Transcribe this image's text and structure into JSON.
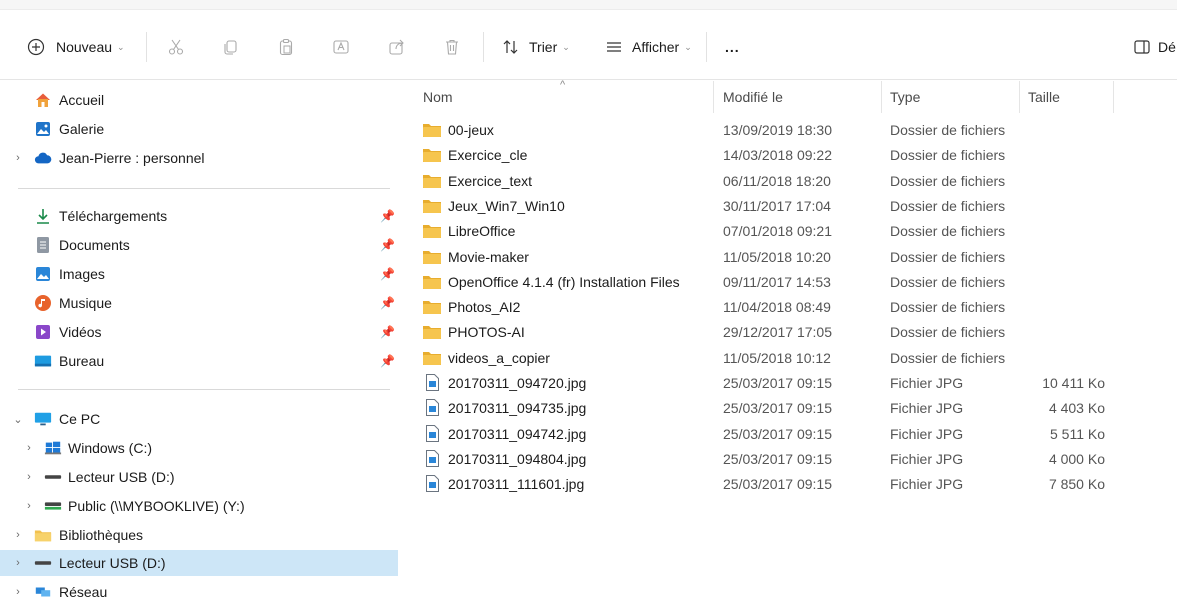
{
  "toolbar": {
    "new_label": "Nouveau",
    "sort_label": "Trier",
    "view_label": "Afficher",
    "more_label": "...",
    "details_label": "Dé"
  },
  "sidebar": {
    "quick": [
      {
        "label": "Accueil",
        "icon": "home-icon"
      },
      {
        "label": "Galerie",
        "icon": "gallery-icon"
      },
      {
        "label": "Jean-Pierre : personnel",
        "icon": "cloud-icon"
      }
    ],
    "pinned": [
      {
        "label": "Téléchargements",
        "icon": "download-icon"
      },
      {
        "label": "Documents",
        "icon": "documents-icon"
      },
      {
        "label": "Images",
        "icon": "images-icon"
      },
      {
        "label": "Musique",
        "icon": "music-icon"
      },
      {
        "label": "Vidéos",
        "icon": "videos-icon"
      },
      {
        "label": "Bureau",
        "icon": "desktop-icon"
      }
    ],
    "tree": [
      {
        "label": "Ce PC",
        "icon": "pc-icon"
      },
      {
        "label": "Windows (C:)",
        "icon": "windows-drive-icon"
      },
      {
        "label": "Lecteur USB (D:)",
        "icon": "usb-drive-icon"
      },
      {
        "label": "Public (\\\\MYBOOKLIVE) (Y:)",
        "icon": "network-drive-icon"
      },
      {
        "label": "Bibliothèques",
        "icon": "library-folder-icon"
      },
      {
        "label": "Lecteur USB (D:)",
        "icon": "usb-drive-icon"
      },
      {
        "label": "Réseau",
        "icon": "network-icon"
      }
    ]
  },
  "columns": {
    "name": "Nom",
    "modified": "Modifié le",
    "type": "Type",
    "size": "Taille"
  },
  "files": [
    {
      "name": "00-jeux",
      "modified": "13/09/2019 18:30",
      "type": "Dossier de fichiers",
      "size": "",
      "kind": "folder"
    },
    {
      "name": "Exercice_cle",
      "modified": "14/03/2018 09:22",
      "type": "Dossier de fichiers",
      "size": "",
      "kind": "folder"
    },
    {
      "name": "Exercice_text",
      "modified": "06/11/2018 18:20",
      "type": "Dossier de fichiers",
      "size": "",
      "kind": "folder"
    },
    {
      "name": "Jeux_Win7_Win10",
      "modified": "30/11/2017 17:04",
      "type": "Dossier de fichiers",
      "size": "",
      "kind": "folder"
    },
    {
      "name": "LibreOffice",
      "modified": "07/01/2018 09:21",
      "type": "Dossier de fichiers",
      "size": "",
      "kind": "folder"
    },
    {
      "name": "Movie-maker",
      "modified": "11/05/2018 10:20",
      "type": "Dossier de fichiers",
      "size": "",
      "kind": "folder"
    },
    {
      "name": "OpenOffice 4.1.4 (fr) Installation Files",
      "modified": "09/11/2017 14:53",
      "type": "Dossier de fichiers",
      "size": "",
      "kind": "folder"
    },
    {
      "name": "Photos_AI2",
      "modified": "11/04/2018 08:49",
      "type": "Dossier de fichiers",
      "size": "",
      "kind": "folder"
    },
    {
      "name": "PHOTOS-AI",
      "modified": "29/12/2017 17:05",
      "type": "Dossier de fichiers",
      "size": "",
      "kind": "folder"
    },
    {
      "name": "videos_a_copier",
      "modified": "11/05/2018 10:12",
      "type": "Dossier de fichiers",
      "size": "",
      "kind": "folder"
    },
    {
      "name": "20170311_094720.jpg",
      "modified": "25/03/2017 09:15",
      "type": "Fichier JPG",
      "size": "10 411 Ko",
      "kind": "jpg"
    },
    {
      "name": "20170311_094735.jpg",
      "modified": "25/03/2017 09:15",
      "type": "Fichier JPG",
      "size": "4 403 Ko",
      "kind": "jpg"
    },
    {
      "name": "20170311_094742.jpg",
      "modified": "25/03/2017 09:15",
      "type": "Fichier JPG",
      "size": "5 511 Ko",
      "kind": "jpg"
    },
    {
      "name": "20170311_094804.jpg",
      "modified": "25/03/2017 09:15",
      "type": "Fichier JPG",
      "size": "4 000 Ko",
      "kind": "jpg"
    },
    {
      "name": "20170311_111601.jpg",
      "modified": "25/03/2017 09:15",
      "type": "Fichier JPG",
      "size": "7 850 Ko",
      "kind": "jpg"
    }
  ],
  "colors": {
    "accent": "#0067c0",
    "selection": "#cde6f7",
    "folder": "#f2c14e"
  }
}
